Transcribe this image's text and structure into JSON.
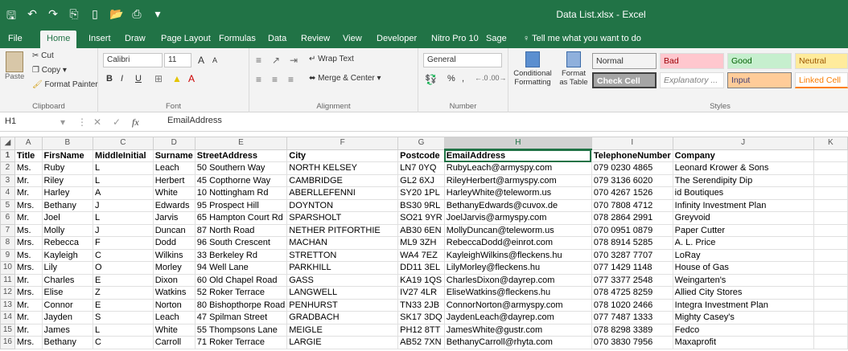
{
  "title": "Data List.xlsx - Excel",
  "qat_icons": [
    "save-icon",
    "undo-icon",
    "redo-icon",
    "paste-icon",
    "new-icon",
    "open-icon",
    "print-icon",
    "customize-icon"
  ],
  "tabs": [
    "File",
    "Home",
    "Insert",
    "Draw",
    "Page Layout",
    "Formulas",
    "Data",
    "Review",
    "View",
    "Developer",
    "Nitro Pro 10",
    "Sage",
    "Tell me what you want to do"
  ],
  "active_tab": "Home",
  "ribbon": {
    "clipboard": {
      "paste": "Paste",
      "cut": "Cut",
      "copy": "Copy",
      "format_painter": "Format Painter",
      "label": "Clipboard"
    },
    "font": {
      "name": "Calibri",
      "size": "11",
      "grow": "A",
      "shrink": "A",
      "bold": "B",
      "italic": "I",
      "underline": "U",
      "label": "Font"
    },
    "alignment": {
      "wrap": "Wrap Text",
      "merge": "Merge & Center",
      "label": "Alignment"
    },
    "number": {
      "format": "General",
      "percent": "%",
      "comma": ",",
      "label": "Number"
    },
    "styles": {
      "conditional": "Conditional Formatting",
      "format_as": "Format as Table",
      "cells": [
        {
          "label": "Normal",
          "bg": "#ffffff",
          "fg": "#000000"
        },
        {
          "label": "Bad",
          "bg": "#ffc7ce",
          "fg": "#9c0006"
        },
        {
          "label": "Good",
          "bg": "#c6efce",
          "fg": "#006100"
        },
        {
          "label": "Neutral",
          "bg": "#ffeb9c",
          "fg": "#9c5700"
        },
        {
          "label": "Check Cell",
          "bg": "#a5a5a5",
          "fg": "#ffffff"
        },
        {
          "label": "Explanatory ...",
          "bg": "#ffffff",
          "fg": "#7f7f7f"
        },
        {
          "label": "Input",
          "bg": "#ffcc99",
          "fg": "#3f3f76"
        },
        {
          "label": "Linked Cell",
          "bg": "#ffffff",
          "fg": "#fa7d00"
        }
      ],
      "label": "Styles"
    }
  },
  "formula_bar": {
    "name_box": "H1",
    "fx": "fx",
    "value": "EmailAddress"
  },
  "columns": [
    "A",
    "B",
    "C",
    "D",
    "E",
    "F",
    "G",
    "H",
    "I",
    "J",
    "K"
  ],
  "selected_column": "H",
  "rows": [
    [
      "1",
      "Title",
      "FirsName",
      "MiddleInitial",
      "Surname",
      "StreetAddress",
      "City",
      "Postcode",
      "EmailAddress",
      "TelephoneNumber",
      "Company",
      ""
    ],
    [
      "2",
      "Ms.",
      "Ruby",
      "L",
      "Leach",
      "50 Southern Way",
      "NORTH KELSEY",
      "LN7 0YQ",
      "RubyLeach@armyspy.com",
      "079 0230 4865",
      "Leonard Krower & Sons",
      ""
    ],
    [
      "3",
      "Mr.",
      "Riley",
      "L",
      "Herbert",
      "45 Copthorne Way",
      "CAMBRIDGE",
      "GL2 6XJ",
      "RileyHerbert@armyspy.com",
      "079 3136 6020",
      "The Serendipity Dip",
      ""
    ],
    [
      "4",
      "Mr.",
      "Harley",
      "A",
      "White",
      "10 Nottingham Rd",
      "ABERLLEFENNI",
      "SY20 1PL",
      "HarleyWhite@teleworm.us",
      "070 4267 1526",
      "id Boutiques",
      ""
    ],
    [
      "5",
      "Mrs.",
      "Bethany",
      "J",
      "Edwards",
      "95 Prospect Hill",
      "DOYNTON",
      "BS30 9RL",
      "BethanyEdwards@cuvox.de",
      "070 7808 4712",
      "Infinity Investment Plan",
      ""
    ],
    [
      "6",
      "Mr.",
      "Joel",
      "L",
      "Jarvis",
      "65 Hampton Court Rd",
      "SPARSHOLT",
      "SO21 9YR",
      "JoelJarvis@armyspy.com",
      "078 2864 2991",
      "Greyvoid",
      ""
    ],
    [
      "7",
      "Ms.",
      "Molly",
      "J",
      "Duncan",
      "87 North Road",
      "NETHER PITFORTHIE",
      "AB30 6EN",
      "MollyDuncan@teleworm.us",
      "070 0951 0879",
      "Paper Cutter",
      ""
    ],
    [
      "8",
      "Mrs.",
      "Rebecca",
      "F",
      "Dodd",
      "96 South Crescent",
      "MACHAN",
      "ML9 3ZH",
      "RebeccaDodd@einrot.com",
      "078 8914 5285",
      "A. L. Price",
      ""
    ],
    [
      "9",
      "Ms.",
      "Kayleigh",
      "C",
      "Wilkins",
      "33 Berkeley Rd",
      "STRETTON",
      "WA4 7EZ",
      "KayleighWilkins@fleckens.hu",
      "070 3287 7707",
      "LoRay",
      ""
    ],
    [
      "10",
      "Mrs.",
      "Lily",
      "O",
      "Morley",
      "94 Well Lane",
      "PARKHILL",
      "DD11 3EL",
      "LilyMorley@fleckens.hu",
      "077 1429 1148",
      "House of Gas",
      ""
    ],
    [
      "11",
      "Mr.",
      "Charles",
      "E",
      "Dixon",
      "60 Old Chapel Road",
      "GASS",
      "KA19 1QS",
      "CharlesDixon@dayrep.com",
      "077 3377 2548",
      "Weingarten's",
      ""
    ],
    [
      "12",
      "Mrs.",
      "Elise",
      "Z",
      "Watkins",
      "52 Roker Terrace",
      "LANGWELL",
      "IV27 4LR",
      "EliseWatkins@fleckens.hu",
      "078 4725 8259",
      "Allied City Stores",
      ""
    ],
    [
      "13",
      "Mr.",
      "Connor",
      "E",
      "Norton",
      "80 Bishopthorpe Road",
      "PENHURST",
      "TN33 2JB",
      "ConnorNorton@armyspy.com",
      "078 1020 2466",
      "Integra Investment Plan",
      ""
    ],
    [
      "14",
      "Mr.",
      "Jayden",
      "S",
      "Leach",
      "47 Spilman Street",
      "GRADBACH",
      "SK17 3DQ",
      "JaydenLeach@dayrep.com",
      "077 7487 1333",
      "Mighty Casey's",
      ""
    ],
    [
      "15",
      "Mr.",
      "James",
      "L",
      "White",
      "55 Thompsons Lane",
      "MEIGLE",
      "PH12 8TT",
      "JamesWhite@gustr.com",
      "078 8298 3389",
      "Fedco",
      ""
    ],
    [
      "16",
      "Mrs.",
      "Bethany",
      "C",
      "Carroll",
      "71 Roker Terrace",
      "LARGIE",
      "AB52 7XN",
      "BethanyCarroll@rhyta.com",
      "070 3830 7956",
      "Maxaprofit",
      ""
    ]
  ]
}
